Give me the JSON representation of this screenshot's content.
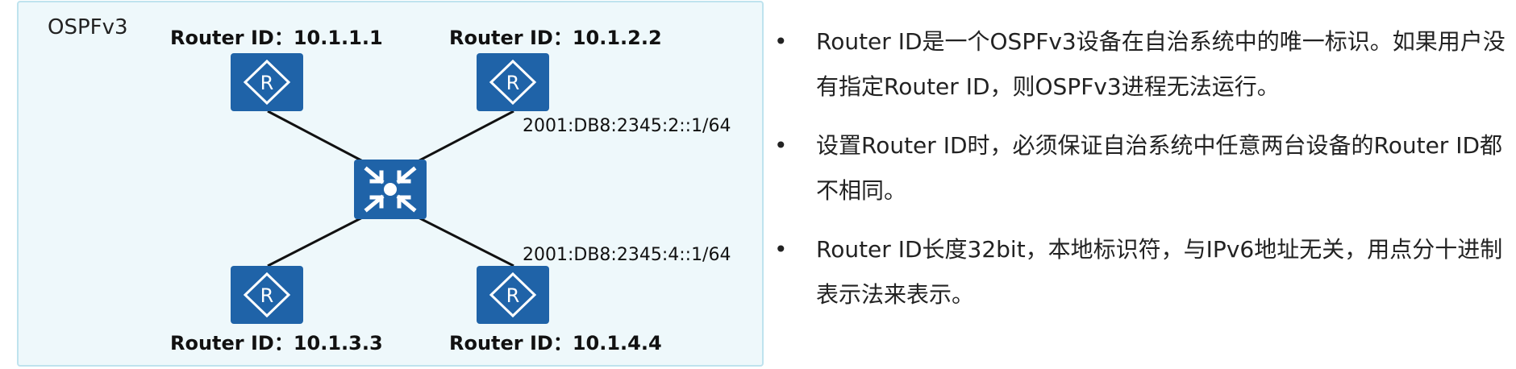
{
  "diagram": {
    "title": "OSPFv3",
    "routers": [
      {
        "label": "Router ID：10.1.1.1",
        "icon": "router-icon"
      },
      {
        "label": "Router ID：10.1.2.2",
        "icon": "router-icon"
      },
      {
        "label": "Router ID：10.1.3.3",
        "icon": "router-icon"
      },
      {
        "label": "Router ID：10.1.4.4",
        "icon": "router-icon"
      }
    ],
    "switch_icon": "switch-icon",
    "interfaces": [
      "2001:DB8:2345:2::1/64",
      "2001:DB8:2345:4::1/64"
    ],
    "colors": {
      "panel_bg": "#eef8fb",
      "panel_border": "#bfe3ee",
      "device": "#1f63a8",
      "link": "#111111"
    }
  },
  "notes": {
    "bullet": "•",
    "items": [
      "Router ID是一个OSPFv3设备在自治系统中的唯一标识。如果用户没有指定Router ID，则OSPFv3进程无法运行。",
      "设置Router ID时，必须保证自治系统中任意两台设备的Router ID都不相同。",
      "Router ID长度32bit，本地标识符，与IPv6地址无关，用点分十进制表示法来表示。"
    ]
  }
}
